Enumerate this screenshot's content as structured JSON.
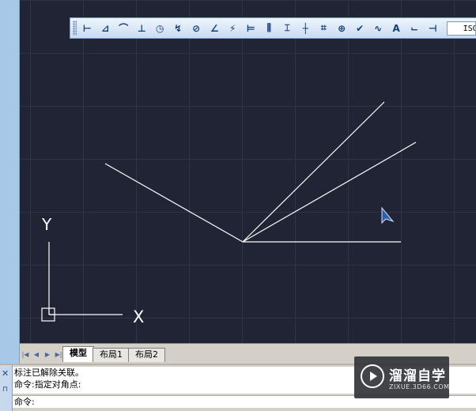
{
  "toolbar": {
    "tools": [
      {
        "name": "linear-dimension-icon",
        "glyph": "⊢"
      },
      {
        "name": "aligned-dimension-icon",
        "glyph": "⊿"
      },
      {
        "name": "arc-length-icon",
        "glyph": "⌒"
      },
      {
        "name": "ordinate-dimension-icon",
        "glyph": "⊥"
      },
      {
        "name": "radius-dimension-icon",
        "glyph": "◷"
      },
      {
        "name": "jogged-radius-icon",
        "glyph": "↯"
      },
      {
        "name": "diameter-dimension-icon",
        "glyph": "⊘"
      },
      {
        "name": "angular-dimension-icon",
        "glyph": "∠"
      },
      {
        "name": "quick-dimension-icon",
        "glyph": "⚡"
      },
      {
        "name": "baseline-dimension-icon",
        "glyph": "⊨"
      },
      {
        "name": "continue-dimension-icon",
        "glyph": "⫼"
      },
      {
        "name": "dimension-space-icon",
        "glyph": "⌶"
      },
      {
        "name": "dimension-break-icon",
        "glyph": "┼"
      },
      {
        "name": "tolerance-icon",
        "glyph": "⌗"
      },
      {
        "name": "center-mark-icon",
        "glyph": "⊕"
      },
      {
        "name": "inspection-icon",
        "glyph": "✔"
      },
      {
        "name": "jogged-linear-icon",
        "glyph": "∿"
      },
      {
        "name": "dimension-edit-icon",
        "glyph": "A"
      },
      {
        "name": "dimension-text-edit-icon",
        "glyph": "⌙"
      },
      {
        "name": "dimension-update-icon",
        "glyph": "⊣"
      }
    ],
    "dim_style_value": "ISO-"
  },
  "tabs": {
    "nav": [
      "|◀",
      "◀",
      "▶",
      "▶|"
    ],
    "model": "模型",
    "layout1": "布局1",
    "layout2": "布局2"
  },
  "ucs": {
    "y_label": "Y",
    "x_label": "X"
  },
  "command": {
    "history": [
      "标注已解除关联。",
      "命令:指定对角点:"
    ],
    "prompt": "命令:"
  },
  "watermark": {
    "title": "溜溜自学",
    "url": "ZIXUE.3D66.COM"
  },
  "colors": {
    "canvas_bg": "#212434",
    "grid_line": "#2d3446",
    "geometry": "#ffffff",
    "toolbar_icon": "#143e78"
  }
}
